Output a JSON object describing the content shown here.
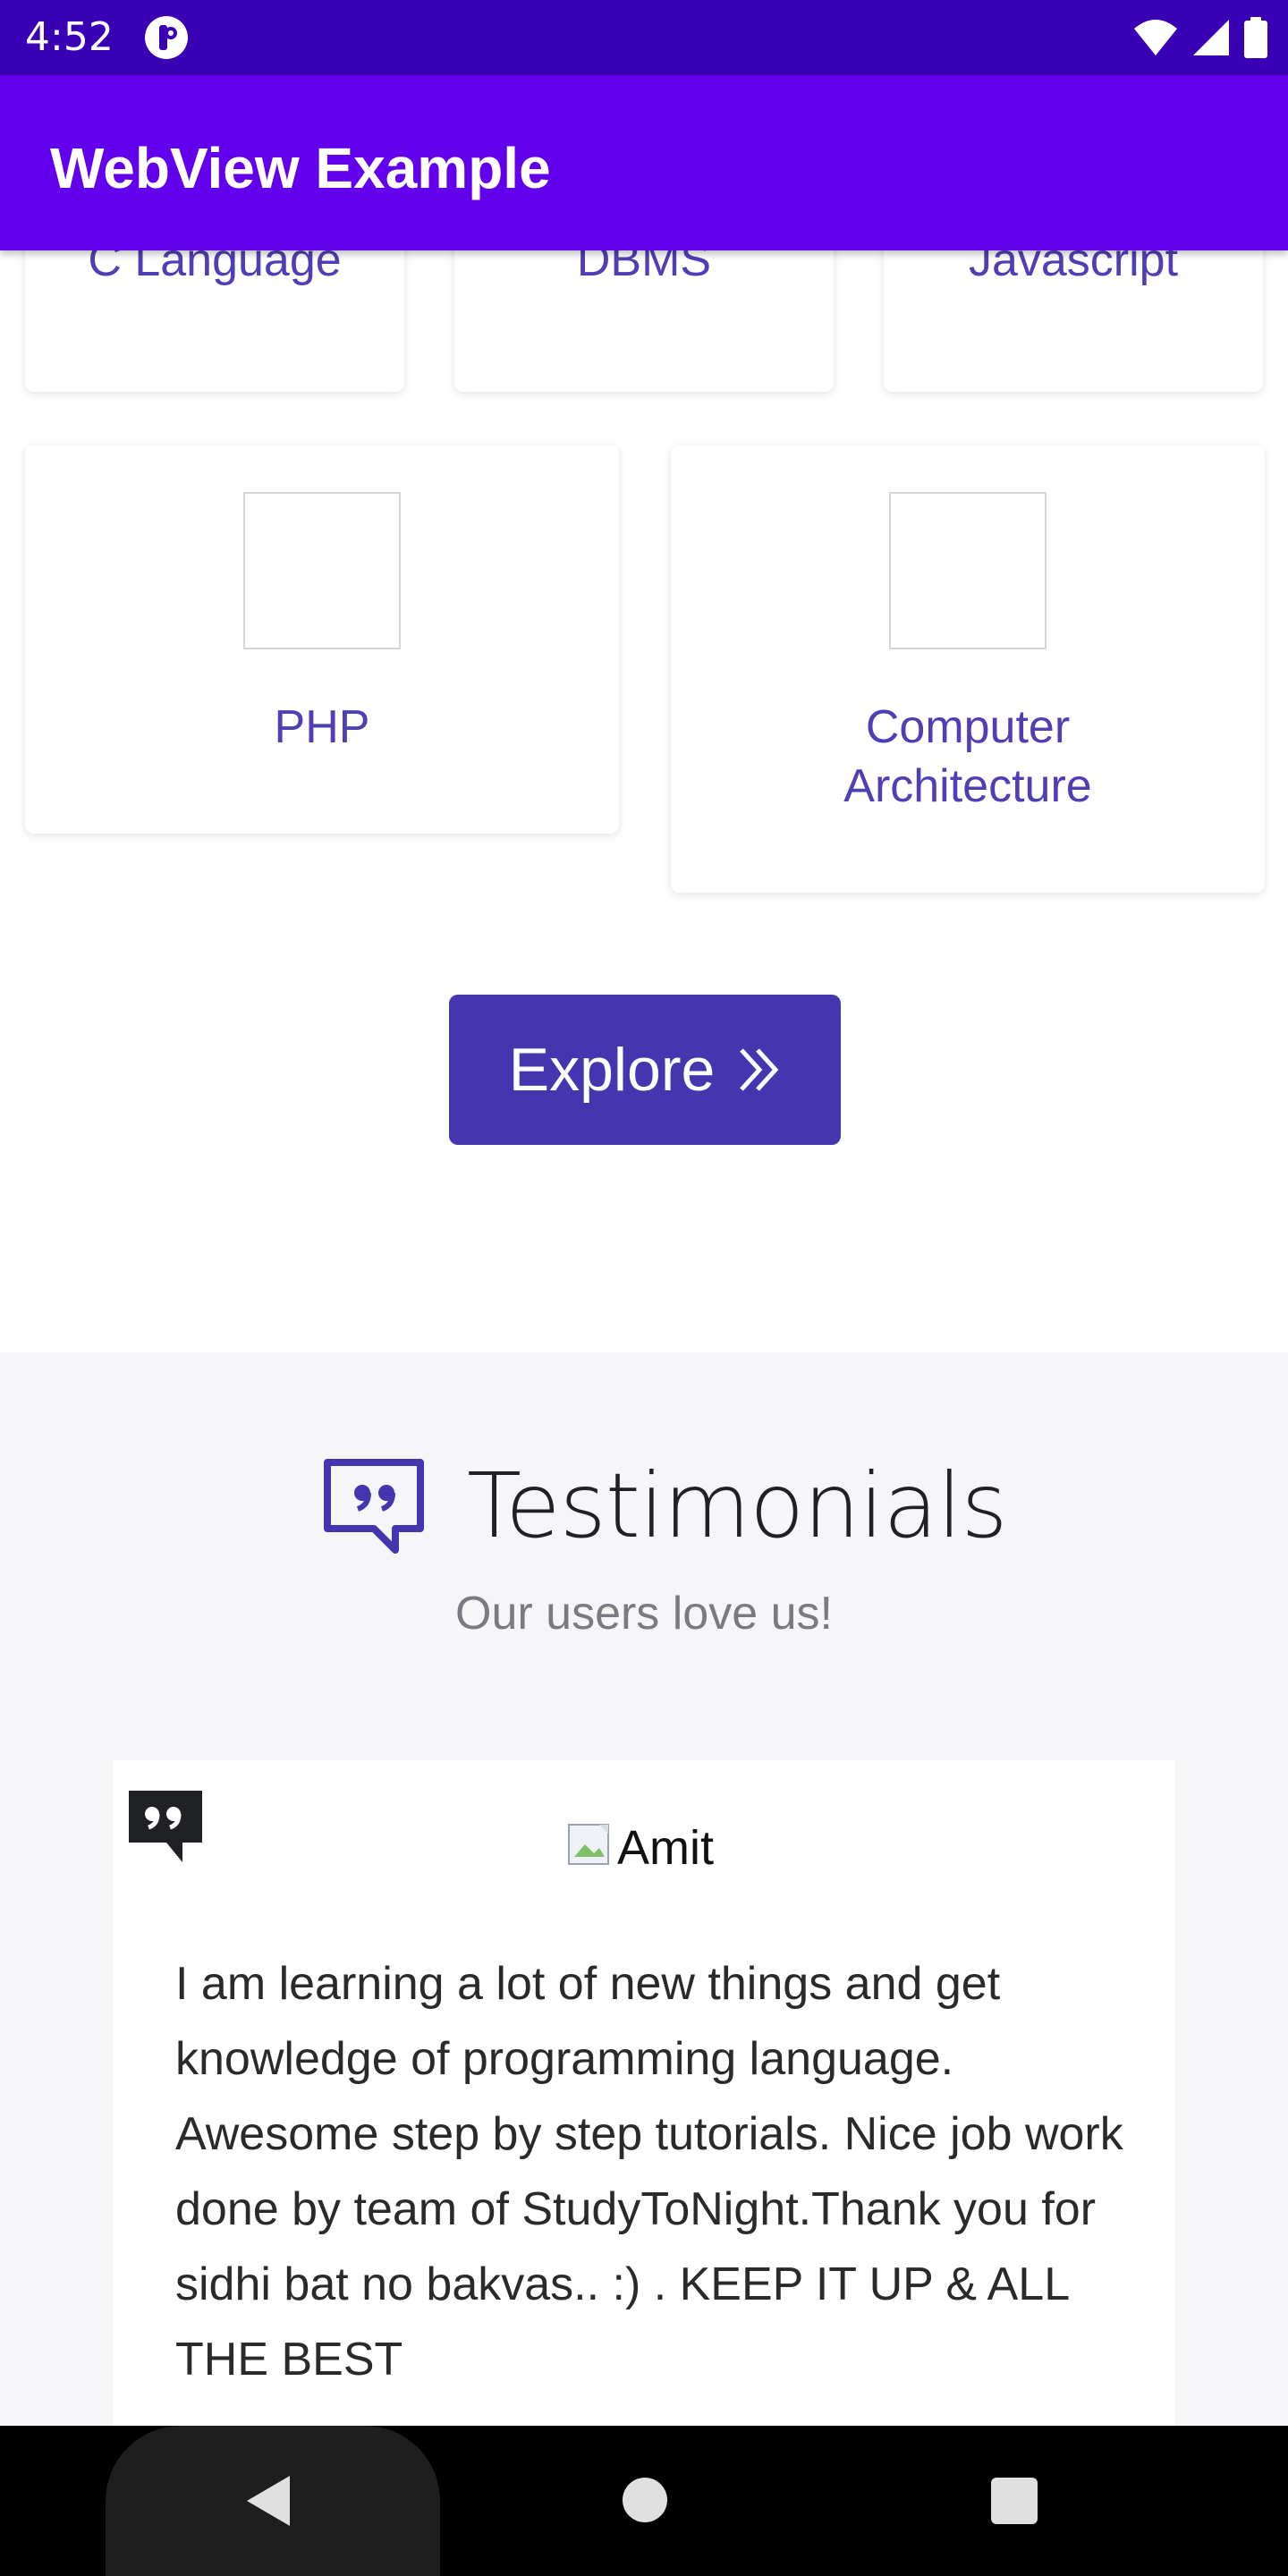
{
  "status_bar": {
    "time": "4:52",
    "icons": [
      "app-notification-icon",
      "wifi-icon",
      "signal-icon",
      "battery-icon"
    ]
  },
  "app_bar": {
    "title": "WebView Example"
  },
  "courses": {
    "row1": [
      "C Language",
      "DBMS",
      "Javascript"
    ],
    "row2": [
      {
        "label_line1": "PHP",
        "label_line2": ""
      },
      {
        "label_line1": "Computer",
        "label_line2": "Architecture"
      }
    ]
  },
  "explore_button": {
    "label": "Explore",
    "icon": "double-chevron-right-icon"
  },
  "testimonials": {
    "heading": "Testimonials",
    "subheading": "Our users love us!",
    "card": {
      "author": "Amit",
      "text": "I am learning a lot of new things and get knowledge of programming language. Awesome step by step tutorials. Nice job work done by team of StudyToNight.Thank you for sidhi bat no bakvas.. :) . KEEP IT UP & ALL THE BEST"
    }
  },
  "colors": {
    "status_bar": "#3A00B3",
    "app_bar": "#6200EE",
    "accent": "#4535AE",
    "card_text": "#4F3FB4",
    "section_bg": "#F6F6F9"
  }
}
